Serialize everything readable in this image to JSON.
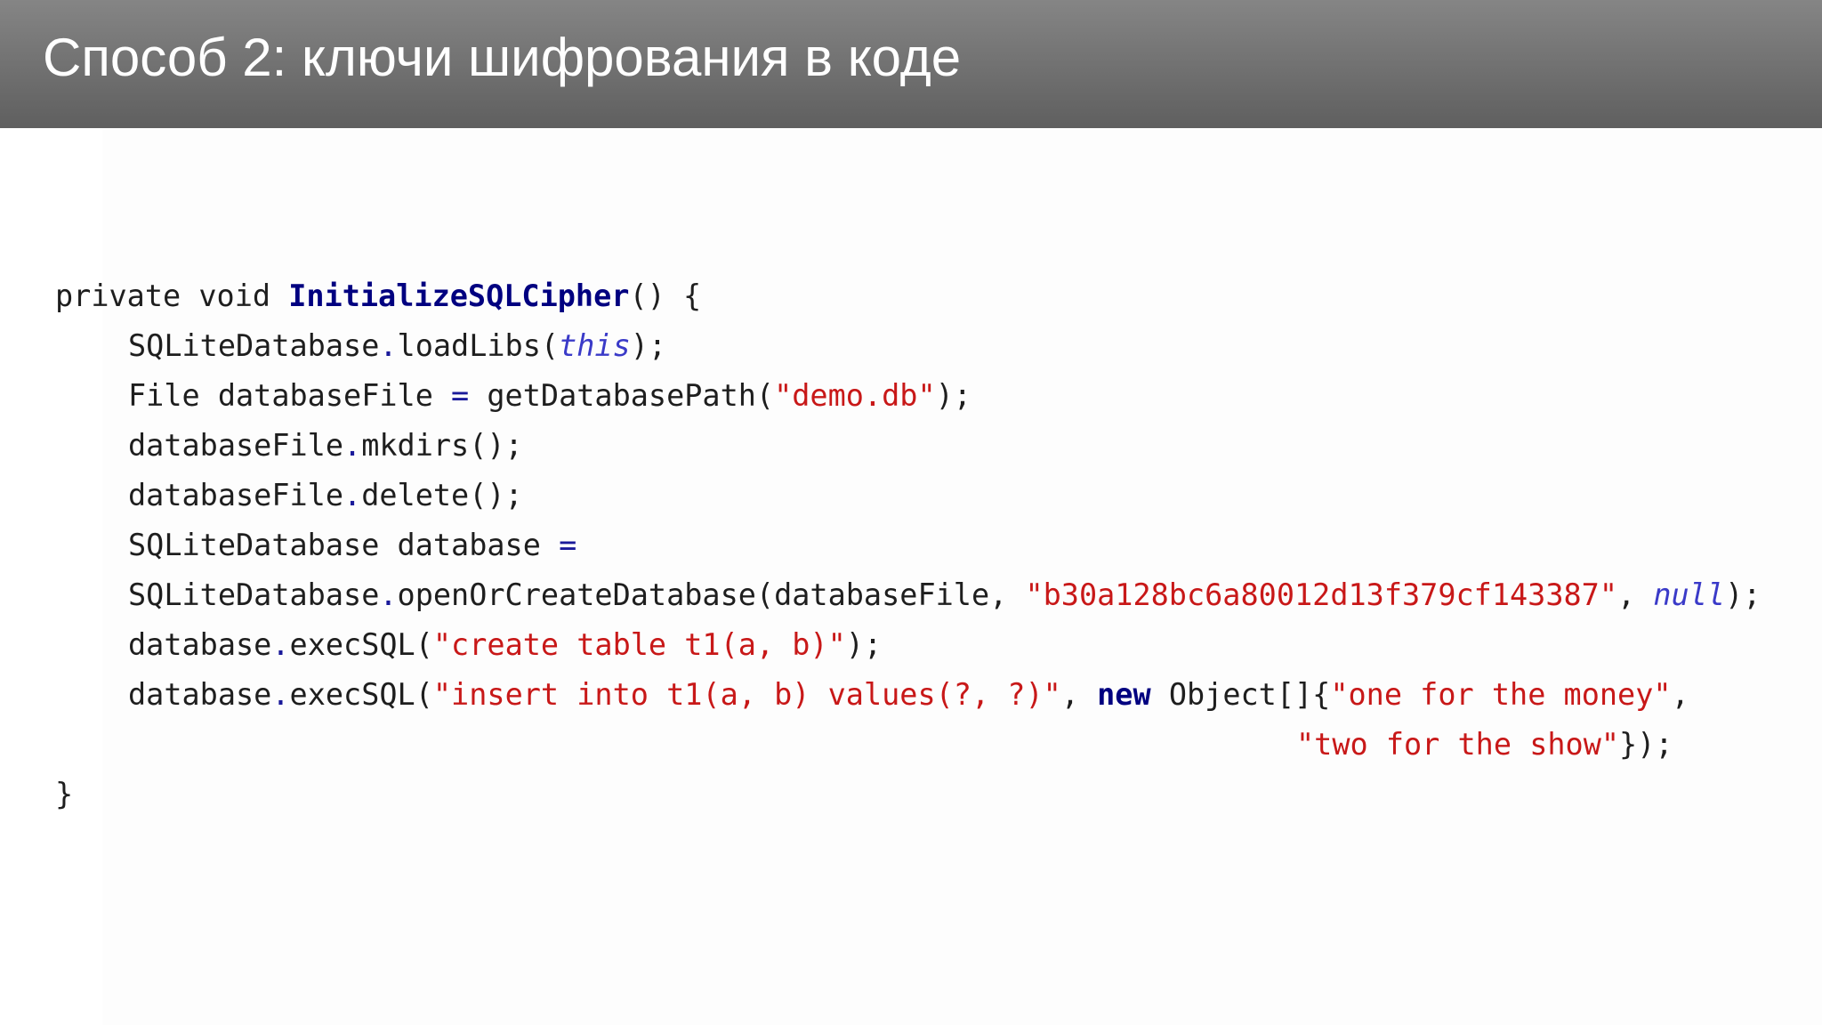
{
  "slide": {
    "title": "Способ 2: ключи шифрования в коде"
  },
  "code": {
    "line1": {
      "kw_private": "private",
      "kw_void": "void",
      "method": "InitializeSQLCipher",
      "tail": "() {"
    },
    "line2": {
      "cls": "SQLiteDatabase",
      "call": "loadLibs(",
      "arg": "this",
      "tail": ");"
    },
    "line3": {
      "decl": "File databaseFile",
      "op": "=",
      "call": "getDatabasePath(",
      "str": "\"demo.db\"",
      "tail": ");"
    },
    "line4": {
      "obj": "databaseFile",
      "call": "mkdirs();"
    },
    "line5": {
      "obj": "databaseFile",
      "call": "delete();"
    },
    "line6": {
      "decl": "SQLiteDatabase database",
      "op": "="
    },
    "line7": {
      "cls": "SQLiteDatabase",
      "call": "openOrCreateDatabase(databaseFile, ",
      "key": "\"b30a128bc6a80012d13f379cf143387\"",
      "sep": ", ",
      "arg": "null",
      "tail": ");"
    },
    "line8": {
      "obj": "database",
      "call": "execSQL(",
      "str": "\"create table t1(a, b)\"",
      "tail": ");"
    },
    "line9": {
      "obj": "database",
      "call": "execSQL(",
      "str": "\"insert into t1(a, b) values(?, ?)\"",
      "sep": ", ",
      "kw_new": "new",
      "type": " Object[]{",
      "str2": "\"one for the money\"",
      "tail": ","
    },
    "line10": {
      "str": "\"two for the show\"",
      "tail": "});"
    },
    "line11": {
      "close": "}"
    }
  }
}
